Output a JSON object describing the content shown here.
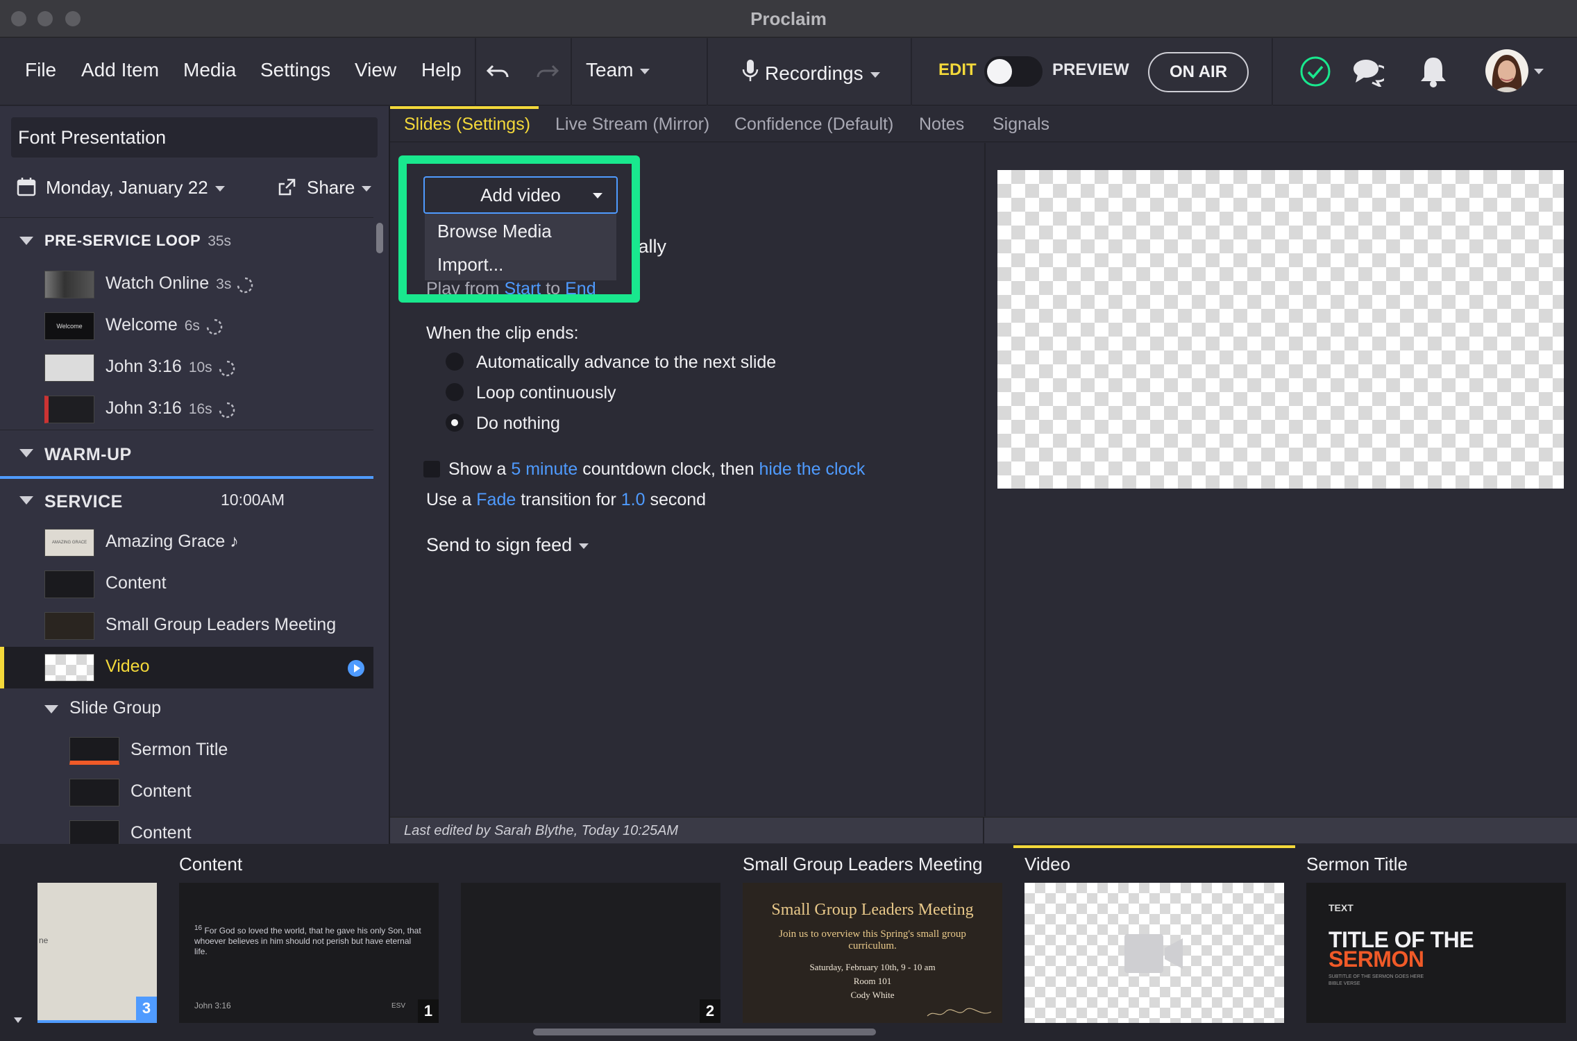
{
  "window": {
    "title": "Proclaim"
  },
  "menu": {
    "file": "File",
    "add_item": "Add Item",
    "media": "Media",
    "settings": "Settings",
    "view": "View",
    "help": "Help",
    "team": "Team",
    "recordings": "Recordings",
    "edit": "EDIT",
    "preview": "PREVIEW",
    "on_air": "ON AIR"
  },
  "sidebar": {
    "presentation_name": "Font Presentation",
    "date": "Monday, January 22",
    "share": "Share",
    "sections": {
      "pre_service": {
        "title": "PRE-SERVICE LOOP",
        "duration": "35s"
      },
      "warm_up": {
        "title": "WARM-UP"
      },
      "service": {
        "title": "SERVICE",
        "time": "10:00AM"
      }
    },
    "pre_service_items": [
      {
        "label": "Watch Online",
        "duration": "3s"
      },
      {
        "label": "Welcome",
        "duration": "6s"
      },
      {
        "label": "John 3:16",
        "duration": "10s"
      },
      {
        "label": "John 3:16",
        "duration": "16s"
      }
    ],
    "service_items": [
      {
        "label": "Amazing Grace ♪"
      },
      {
        "label": "Content"
      },
      {
        "label": "Small Group Leaders Meeting"
      },
      {
        "label": "Video"
      }
    ],
    "slide_group": {
      "label": "Slide Group",
      "items": [
        {
          "label": "Sermon Title"
        },
        {
          "label": "Content"
        },
        {
          "label": "Content"
        }
      ]
    },
    "thumb_text": {
      "welcome": "Welcome",
      "amazing_grace": "AMAZING GRACE"
    }
  },
  "tabs": [
    {
      "label": "Slides (Settings)"
    },
    {
      "label": "Live Stream (Mirror)"
    },
    {
      "label": "Confidence (Default)"
    },
    {
      "label": "Notes"
    },
    {
      "label": "Signals"
    }
  ],
  "settings": {
    "add_video_label": "Add video",
    "dropdown_items": [
      "Browse Media",
      "Import..."
    ],
    "behind_text": "tally",
    "play_from_prefix": "Play from",
    "play_from_start": "Start",
    "play_from_to": "to",
    "play_from_end": "End",
    "clip_ends_label": "When the clip ends:",
    "clip_end_options": [
      "Automatically advance to the next slide",
      "Loop continuously",
      "Do nothing"
    ],
    "countdown": {
      "prefix": "Show a",
      "duration": "5 minute",
      "middle": "countdown clock, then",
      "action": "hide the clock"
    },
    "transition": {
      "prefix": "Use a",
      "type": "Fade",
      "middle": "transition for",
      "seconds": "1.0",
      "suffix": "second"
    },
    "sign_feed": "Send to sign feed"
  },
  "status": {
    "last_edited": "Last edited by Sarah Blythe, Today 10:25AM"
  },
  "filmstrip": {
    "titles": {
      "content": "Content",
      "small_group": "Small Group Leaders Meeting",
      "video": "Video",
      "sermon": "Sermon Title"
    },
    "badges": {
      "first": "3",
      "content": "1",
      "blank": "2"
    },
    "first_snippet": "ne",
    "verse": {
      "number": "16",
      "text": "For God so loved the world, that he gave his only Son, that whoever believes in him should not perish but have eternal life.",
      "ref": "John 3:16",
      "version": "ESV"
    },
    "small_group_card": {
      "title": "Small Group Leaders Meeting",
      "subtitle": "Join us to overview this Spring's small group curriculum.",
      "date": "Saturday, February 10th, 9 - 10 am",
      "room": "Room 101",
      "person": "Cody White"
    },
    "sermon_card": {
      "kicker": "TEXT",
      "title_line1": "TITLE OF THE",
      "title_line2": "SERMON",
      "subtitle": "SUBTITLE OF THE SERMON GOES HERE",
      "verse": "BIBLE VERSE"
    }
  },
  "colors": {
    "accent": "#f4d93a",
    "link": "#4f9bff",
    "highlight": "#19e88e",
    "status_ok": "#19e88e",
    "sermon_orange": "#f05a28"
  }
}
